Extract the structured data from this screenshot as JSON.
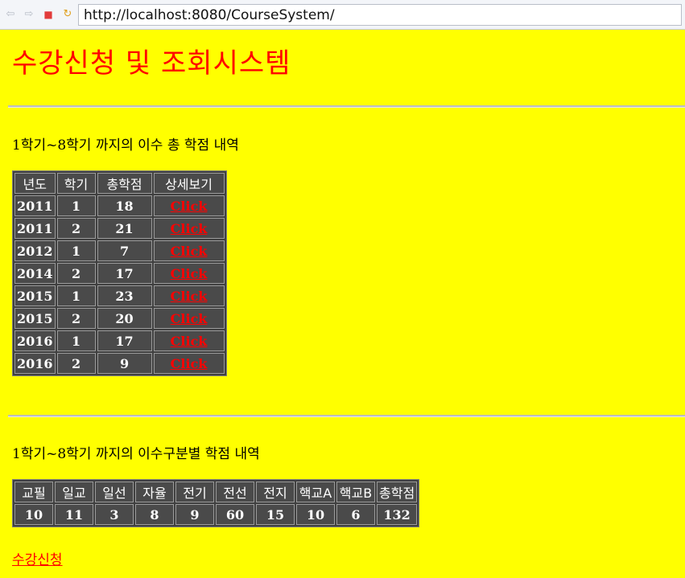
{
  "browser": {
    "url": "http://localhost:8080/CourseSystem/",
    "icons": [
      "back-arrow-icon",
      "forward-arrow-icon",
      "stop-icon",
      "reload-icon"
    ]
  },
  "page": {
    "title": "수강신청 및 조회시스템",
    "section1_title": "1학기~8학기 까지의 이수 총 학점 내역",
    "section2_title": "1학기~8학기 까지의 이수구분별 학점 내역",
    "link_label": "수강신청"
  },
  "totals_table": {
    "headers": [
      "년도",
      "학기",
      "총학점",
      "상세보기"
    ],
    "rows": [
      {
        "year": "2011",
        "term": "1",
        "credits": "18",
        "link": "Click"
      },
      {
        "year": "2011",
        "term": "2",
        "credits": "21",
        "link": "Click"
      },
      {
        "year": "2012",
        "term": "1",
        "credits": "7",
        "link": "Click"
      },
      {
        "year": "2014",
        "term": "2",
        "credits": "17",
        "link": "Click"
      },
      {
        "year": "2015",
        "term": "1",
        "credits": "23",
        "link": "Click"
      },
      {
        "year": "2015",
        "term": "2",
        "credits": "20",
        "link": "Click"
      },
      {
        "year": "2016",
        "term": "1",
        "credits": "17",
        "link": "Click"
      },
      {
        "year": "2016",
        "term": "2",
        "credits": "9",
        "link": "Click"
      }
    ]
  },
  "category_table": {
    "headers": [
      "교필",
      "일교",
      "일선",
      "자율",
      "전기",
      "전선",
      "전지",
      "핵교A",
      "핵교B",
      "총학점"
    ],
    "values": [
      "10",
      "11",
      "3",
      "8",
      "9",
      "60",
      "15",
      "10",
      "6",
      "132"
    ]
  },
  "colors": {
    "background": "#ffff00",
    "title": "#ff0000",
    "table_cell": "#4a4a4a",
    "link": "#ff0000"
  }
}
